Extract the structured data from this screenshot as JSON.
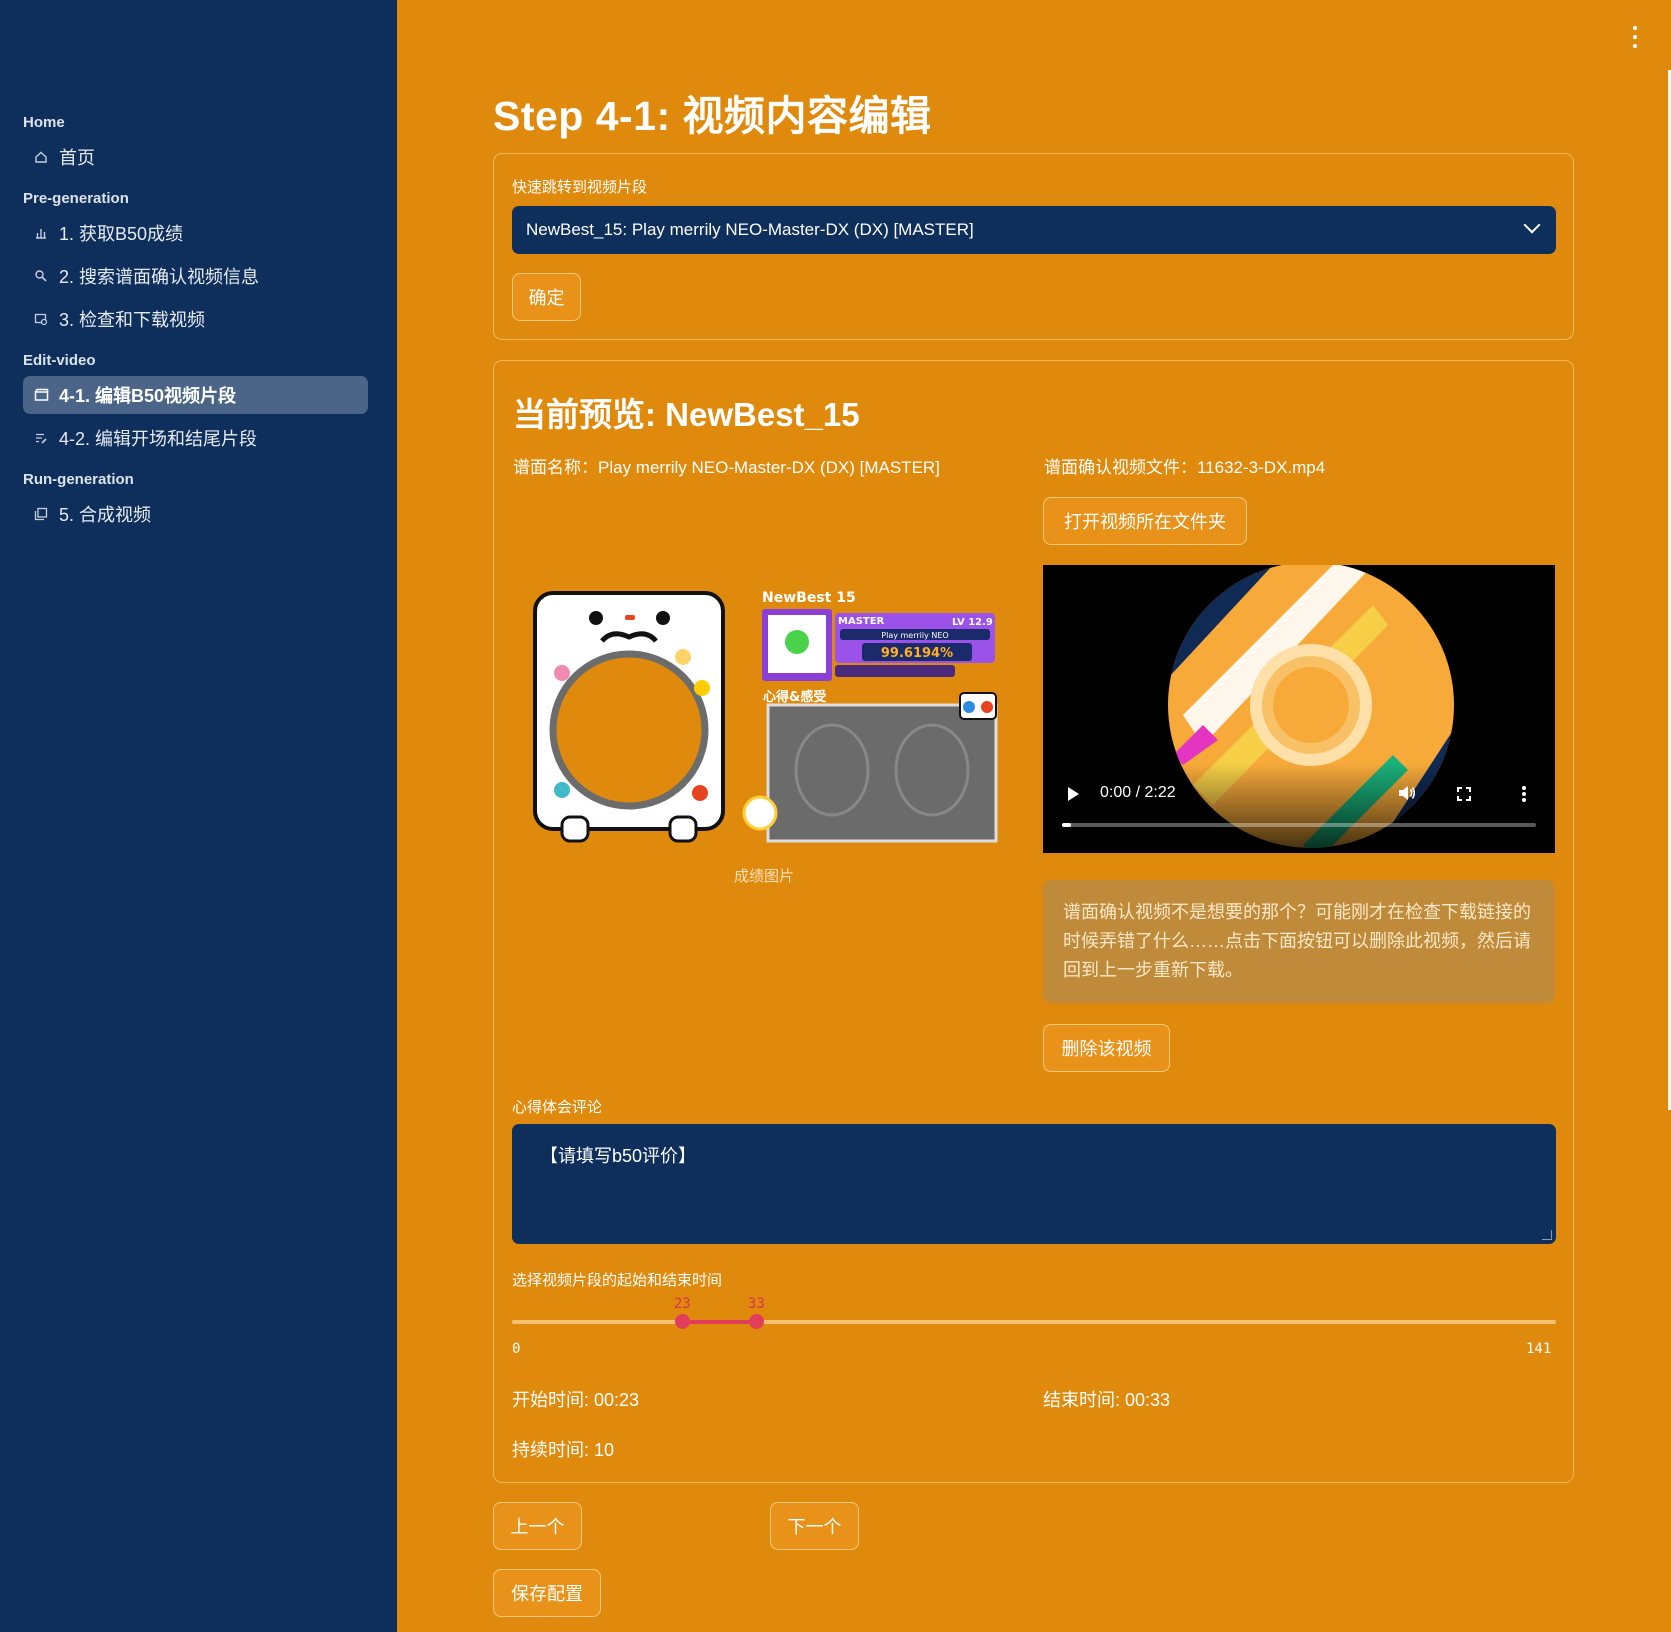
{
  "sidebar": {
    "sections": [
      {
        "title": "Home",
        "items": [
          {
            "label": "首页",
            "icon": "home-icon"
          }
        ]
      },
      {
        "title": "Pre-generation",
        "items": [
          {
            "label": "1. 获取B50成绩",
            "icon": "bar-chart-icon"
          },
          {
            "label": "2. 搜索谱面确认视频信息",
            "icon": "search-icon"
          },
          {
            "label": "3. 检查和下载视频",
            "icon": "video-check-icon"
          }
        ]
      },
      {
        "title": "Edit-video",
        "items": [
          {
            "label": "4-1. 编辑B50视频片段",
            "icon": "clapperboard-icon",
            "active": true
          },
          {
            "label": "4-2. 编辑开场和结尾片段",
            "icon": "edit-list-icon"
          }
        ]
      },
      {
        "title": "Run-generation",
        "items": [
          {
            "label": "5. 合成视频",
            "icon": "library-icon"
          }
        ]
      }
    ]
  },
  "page": {
    "title": "Step 4-1: 视频内容编辑"
  },
  "jump": {
    "label": "快速跳转到视频片段",
    "selected": "NewBest_15: Play merrily NEO-Master-DX (DX) [MASTER]",
    "confirm": "确定"
  },
  "preview": {
    "title": "当前预览: NewBest_15",
    "chart_name": "谱面名称：Play merrily NEO-Master-DX (DX) [MASTER]",
    "video_file": "谱面确认视频文件：11632-3-DX.mp4",
    "open_folder": "打开视频所在文件夹",
    "image_caption": "成绩图片",
    "card": {
      "header": "NewBest 15",
      "difficulty": "MASTER",
      "level": "LV 12.9",
      "song": "Play merrily NEO",
      "score": "99.6194%",
      "comment_title": "心得&感受"
    },
    "video": {
      "time": "0:00 / 2:22",
      "progress": 0.0
    },
    "warning": "谱面确认视频不是想要的那个？可能刚才在检查下载链接的时候弄错了什么……点击下面按钮可以删除此视频，然后请回到上一步重新下载。",
    "delete": "删除该视频"
  },
  "comment": {
    "label": "心得体会评论",
    "value": "【请填写b50评价】"
  },
  "range": {
    "label": "选择视频片段的起始和结束时间",
    "min": 0,
    "max": 141,
    "start": 23,
    "end": 33,
    "min_label": "0",
    "max_label": "141",
    "start_label": "23",
    "end_label": "33"
  },
  "stats": {
    "start": "开始时间: 00:23",
    "end": "结束时间: 00:33",
    "duration": "持续时间: 10"
  },
  "nav": {
    "prev": "上一个",
    "next": "下一个",
    "save": "保存配置"
  },
  "colors": {
    "background": "#e08a0d",
    "sidebar": "#0e2f5b",
    "accent": "#e13e5b"
  }
}
